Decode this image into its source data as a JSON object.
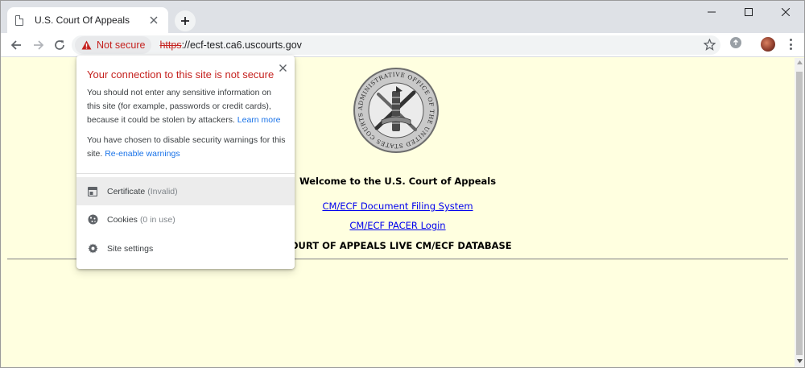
{
  "tab": {
    "title": "U.S. Court Of Appeals"
  },
  "toolbar": {
    "security_label": "Not secure",
    "url_scheme": "https",
    "url_rest": "://ecf-test.ca6.uscourts.gov"
  },
  "seal": {
    "ring_text": "ADMINISTRATIVE OFFICE OF THE UNITED STATES COURTS"
  },
  "page": {
    "welcome": "Welcome to the U.S. Court of Appeals",
    "links": [
      "CM/ECF Document Filing System",
      "CM/ECF PACER Login"
    ],
    "live_db": "COURT OF APPEALS LIVE CM/ECF DATABASE"
  },
  "popup": {
    "title": "Your connection to this site is not secure",
    "para1": "You should not enter any sensitive information on this site (for example, passwords or credit cards), because it could be stolen by attackers.",
    "para1_link": "Learn more",
    "para2": "You have chosen to disable security warnings for this site.",
    "para2_link": "Re-enable warnings",
    "items": [
      {
        "label": "Certificate",
        "sub": "(Invalid)",
        "icon": "certificate-icon"
      },
      {
        "label": "Cookies",
        "sub": "(0 in use)",
        "icon": "cookie-icon"
      },
      {
        "label": "Site settings",
        "sub": "",
        "icon": "gear-icon"
      }
    ]
  },
  "colors": {
    "page_bg": "#ffffe0",
    "warning_red": "#c5221f",
    "link_blue": "#0000ee",
    "popup_link": "#1a73e8"
  }
}
